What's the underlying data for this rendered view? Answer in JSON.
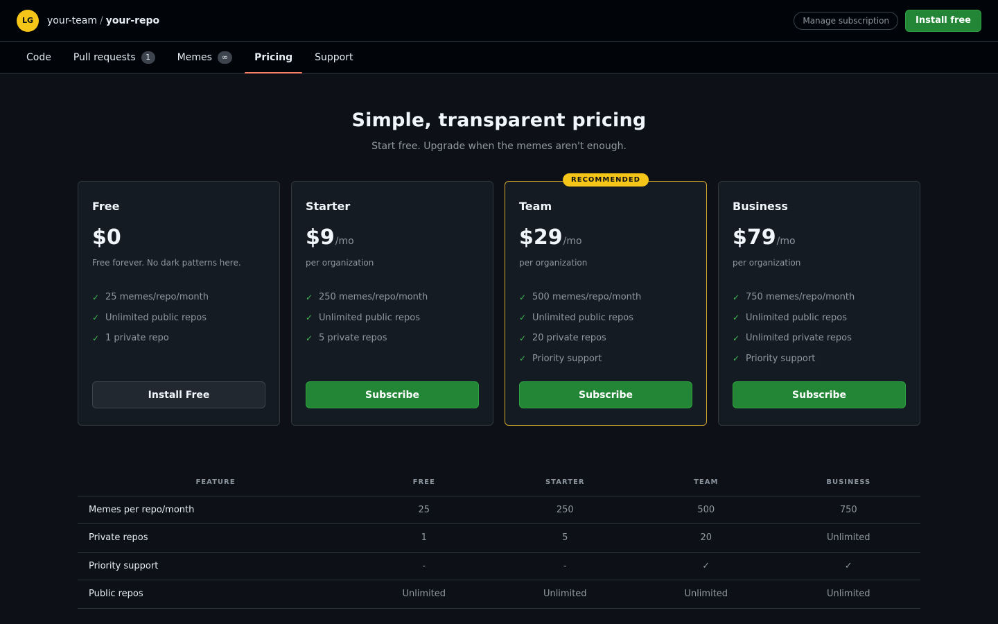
{
  "header": {
    "avatar_initials": "LG",
    "team": "your-team",
    "separator": "/",
    "repo": "your-repo",
    "manage_label": "Manage subscription",
    "install_label": "Install free"
  },
  "tabs": [
    {
      "label": "Code",
      "count": null
    },
    {
      "label": "Pull requests",
      "count": "1"
    },
    {
      "label": "Memes",
      "count": "∞"
    },
    {
      "label": "Pricing",
      "count": null,
      "active": true
    },
    {
      "label": "Support",
      "count": null
    }
  ],
  "hero": {
    "title": "Simple, transparent pricing",
    "subtitle": "Start free. Upgrade when the memes aren't enough."
  },
  "plans": [
    {
      "name": "Free",
      "amount": "$0",
      "per": "",
      "desc": "Free forever. No dark patterns here.",
      "features": [
        "25 memes/repo/month",
        "Unlimited public repos",
        "1 private repo"
      ],
      "button": "Install Free",
      "button_style": "secondary",
      "recommended": false
    },
    {
      "name": "Starter",
      "amount": "$9",
      "per": "/mo",
      "desc": "per organization",
      "features": [
        "250 memes/repo/month",
        "Unlimited public repos",
        "5 private repos"
      ],
      "button": "Subscribe",
      "button_style": "primary",
      "recommended": false
    },
    {
      "name": "Team",
      "amount": "$29",
      "per": "/mo",
      "desc": "per organization",
      "features": [
        "500 memes/repo/month",
        "Unlimited public repos",
        "20 private repos",
        "Priority support"
      ],
      "button": "Subscribe",
      "button_style": "primary",
      "recommended": true,
      "badge": "RECOMMENDED"
    },
    {
      "name": "Business",
      "amount": "$79",
      "per": "/mo",
      "desc": "per organization",
      "features": [
        "750 memes/repo/month",
        "Unlimited public repos",
        "Unlimited private repos",
        "Priority support"
      ],
      "button": "Subscribe",
      "button_style": "primary",
      "recommended": false
    }
  ],
  "compare": {
    "headers": [
      "FEATURE",
      "FREE",
      "STARTER",
      "TEAM",
      "BUSINESS"
    ],
    "rows": [
      [
        "Memes per repo/month",
        "25",
        "250",
        "500",
        "750"
      ],
      [
        "Private repos",
        "1",
        "5",
        "20",
        "Unlimited"
      ],
      [
        "Priority support",
        "-",
        "-",
        "✓",
        "✓"
      ],
      [
        "Public repos",
        "Unlimited",
        "Unlimited",
        "Unlimited",
        "Unlimited"
      ]
    ]
  },
  "icons": {
    "check": "check-icon"
  },
  "colors": {
    "accent_green": "#238636",
    "recommended_yellow": "#f5c518",
    "tab_underline": "#f78166"
  }
}
